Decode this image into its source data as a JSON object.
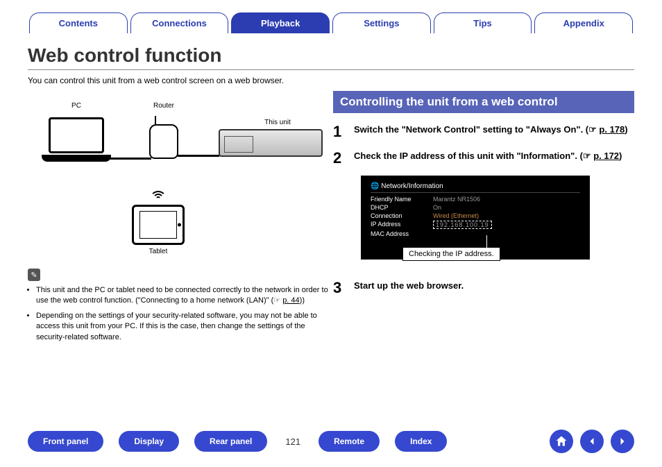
{
  "tabs": [
    "Contents",
    "Connections",
    "Playback",
    "Settings",
    "Tips",
    "Appendix"
  ],
  "active_tab": 2,
  "page_title": "Web control function",
  "intro": "You can control this unit from a web control screen on a web browser.",
  "diagram": {
    "pc_label": "PC",
    "router_label": "Router",
    "unit_label": "This unit",
    "tablet_label": "Tablet"
  },
  "notes": {
    "bullets": [
      {
        "pre": "This unit and the PC or tablet need to be connected correctly to the network in order to use the web control function. (\"Connecting to a home network (LAN)\" (",
        "link": "p. 44",
        "post": "))"
      },
      {
        "text": "Depending on the settings of your security-related software, you may not be able to access this unit from your PC. If this is the case, then change the settings of the security-related software."
      }
    ]
  },
  "section_header": "Controlling the unit from a web control",
  "steps": [
    {
      "num": "1",
      "text_a": "Switch the \"Network Control\" setting to \"Always On\". (",
      "link": "p. 178",
      "text_b": ")"
    },
    {
      "num": "2",
      "text_a": "Check the IP address of this unit with \"Information\". (",
      "link": "p. 172",
      "text_b": ")"
    },
    {
      "num": "3",
      "text_a": "Start up the web browser.",
      "link": "",
      "text_b": ""
    }
  ],
  "info_panel": {
    "title": "Network/Information",
    "rows": [
      {
        "k": "Friendly Name",
        "v": "Marantz NR1506"
      },
      {
        "k": "DHCP",
        "v": "On"
      },
      {
        "k": "Connection",
        "v": "Wired (Ethernet)",
        "hl": true
      },
      {
        "k": "IP Address",
        "v": "192.168.100.19",
        "box": true
      },
      {
        "k": "MAC Address",
        "v": ""
      }
    ],
    "callout": "Checking the IP address."
  },
  "bottom_buttons": [
    "Front panel",
    "Display",
    "Rear panel"
  ],
  "page_number": "121",
  "bottom_buttons2": [
    "Remote",
    "Index"
  ]
}
